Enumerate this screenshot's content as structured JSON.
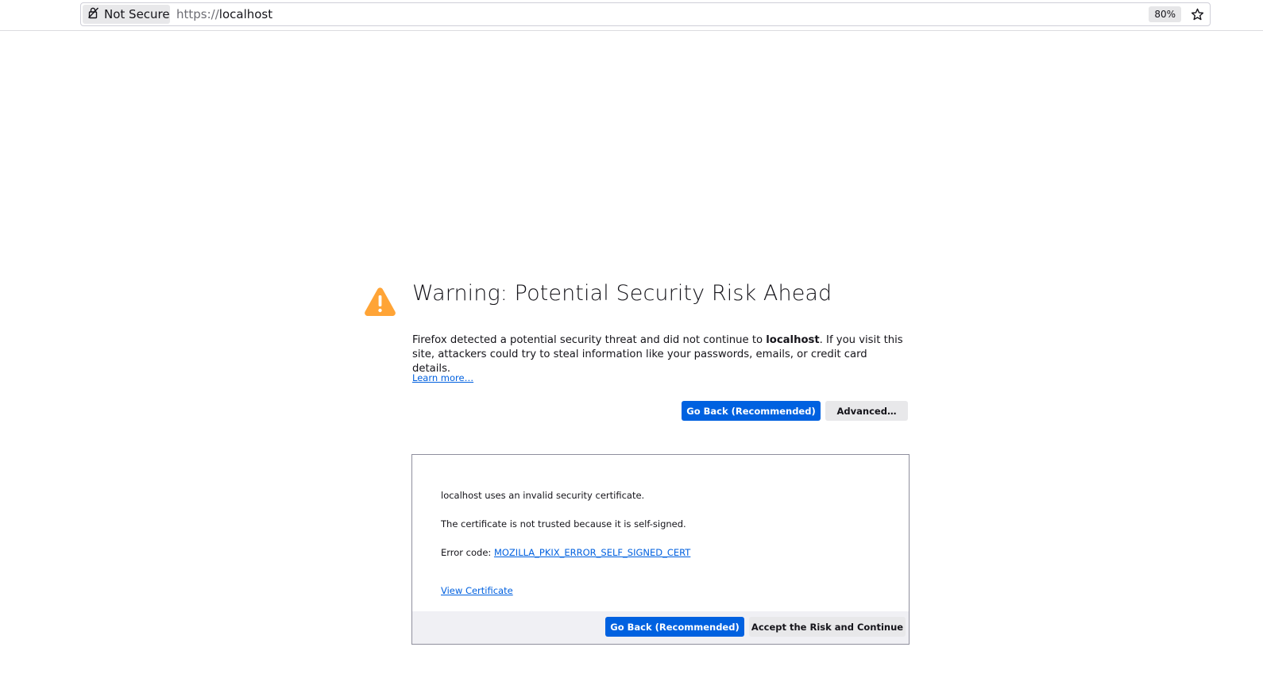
{
  "urlbar": {
    "identity_label": "Not Secure",
    "url_scheme": "https://",
    "url_host": "localhost",
    "zoom": "80%"
  },
  "error_page": {
    "title": "Warning: Potential Security Risk Ahead",
    "desc_before": "Firefox detected a potential security threat and did not continue to ",
    "desc_host": "localhost",
    "desc_after": ". If you visit this site, attackers could try to steal information like your passwords, emails, or credit card details.",
    "learn_more": "Learn more…",
    "go_back_label": "Go Back (Recommended)",
    "advanced_label": "Advanced…"
  },
  "advanced_panel": {
    "invalid_cert_text": "localhost uses an invalid security certificate.",
    "reason_text": "The certificate is not trusted because it is self-signed.",
    "error_code_prefix": "Error code: ",
    "error_code": "MOZILLA_PKIX_ERROR_SELF_SIGNED_CERT",
    "view_certificate": "View Certificate",
    "go_back_label": "Go Back (Recommended)",
    "accept_label": "Accept the Risk and Continue"
  },
  "colors": {
    "primary_button": "#0061e0",
    "link": "#0060df",
    "warning_icon": "#ffa436"
  }
}
